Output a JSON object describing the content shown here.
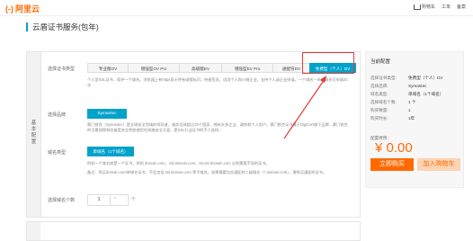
{
  "header": {
    "logo_text": "阿里云",
    "logo_mark": "(-)",
    "links": [
      "购物车",
      "工单",
      "备案"
    ]
  },
  "page_title": "云盾证书服务(包年)",
  "side_label": "基本配置",
  "cert_type": {
    "label": "选择证书类型",
    "tabs": [
      "专业版OV",
      "增强型OV Pro",
      "高级版EV",
      "增强型EV Pro",
      "通配符DV",
      "免费型（个人）DV"
    ],
    "selected_index": 5,
    "desc": "个人型SSL证书，保护一个域名。浏览器上有https显示并有绿锁标识。快速签发，适用个人和小微企业，支持个人或企业申请。一个域名一年内最多可申请20次"
  },
  "brand": {
    "label": "选择品牌",
    "value": "Symantec",
    "desc": "赛门铁克（Symantec）是全球安全领域的领导者，服务全球超过25个国家，拥有众多企业、政府和个人用户。赛门铁克证书属于DigiCert旗下品牌，赛门铁克的可靠保障和信誉度安全性能使您在网络安全方面，是SSL行业证书的不二选择。"
  },
  "domain": {
    "label": "域名类型",
    "value": "单域名（1个域名）",
    "desc1": "例如一个域名就是一个证书，例如 domain.com、ssl.domain.com、ssl.ssl.domain.com 分别需要不同的证书。",
    "desc2": "备注：购买domain.com单域名证书，不会包含 ssl.domain.com 等子域名，如果需要包含通配符二级域名（*.domain.com），需购买通配符证书。"
  },
  "domain_count": {
    "label": "选择域名个数",
    "value": "1",
    "unit": "个"
  },
  "summary": {
    "title": "当前配置",
    "rows": [
      {
        "k": "选择证书类型:",
        "v": "免费型（个人）DV"
      },
      {
        "k": "选择品牌:",
        "v": "Symantec"
      },
      {
        "k": "域名类型:",
        "v": "单域名（1个域名）"
      },
      {
        "k": "选择域名个数:",
        "v": "1 个"
      },
      {
        "k": "购买数量:",
        "v": "1"
      },
      {
        "k": "购买时长:",
        "v": "1年"
      }
    ],
    "fee_label": "配置费用：",
    "price": "¥ 0.00",
    "buy_label": "立即购买",
    "cart_label": "加入购物车"
  },
  "colors": {
    "accent": "#00a2ca",
    "brand": "#ff6a00",
    "annotation": "#e83838"
  }
}
